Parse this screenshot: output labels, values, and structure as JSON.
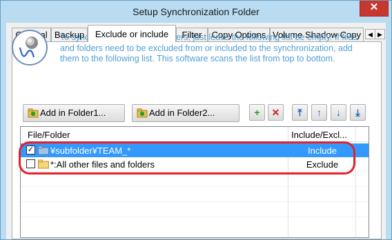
{
  "window": {
    "title": "Setup Synchronization Folder",
    "close_glyph": "✕"
  },
  "tabs": [
    {
      "label": "General"
    },
    {
      "label": "Backup"
    },
    {
      "label": "Exclude or include",
      "active": true
    },
    {
      "label": "Filter"
    },
    {
      "label": "Copy Options"
    },
    {
      "label": "Volume Shadow Copy"
    }
  ],
  "tab_scroll": {
    "left_glyph": "◀",
    "right_glyph": "▶"
  },
  "info_text": "To synchronize all the sub-folders, just leave the following list be empty. If files and folders need to be excluded from or included to the synchronization, add them to the following list. This software scans the list from top to bottom.",
  "buttons": {
    "add_folder1": "Add in Folder1...",
    "add_folder2": "Add in Folder2...",
    "add_icon": "+",
    "remove_icon": "✕",
    "move_top": "⤒",
    "move_up": "↑",
    "move_down": "↓",
    "move_bottom": "⤓"
  },
  "list": {
    "columns": [
      "File/Folder",
      "Include/Excl..."
    ],
    "rows": [
      {
        "checked": true,
        "name": "¥subfolder¥TEAM_*",
        "status": "Include",
        "selected": true
      },
      {
        "checked": false,
        "name": "*:All other files and folders",
        "status": "Exclude",
        "selected": false
      }
    ]
  },
  "colors": {
    "info_text": "#4f9fd4",
    "selection": "#3399ff",
    "annotation": "#e5202a",
    "close_button": "#c7372f"
  }
}
